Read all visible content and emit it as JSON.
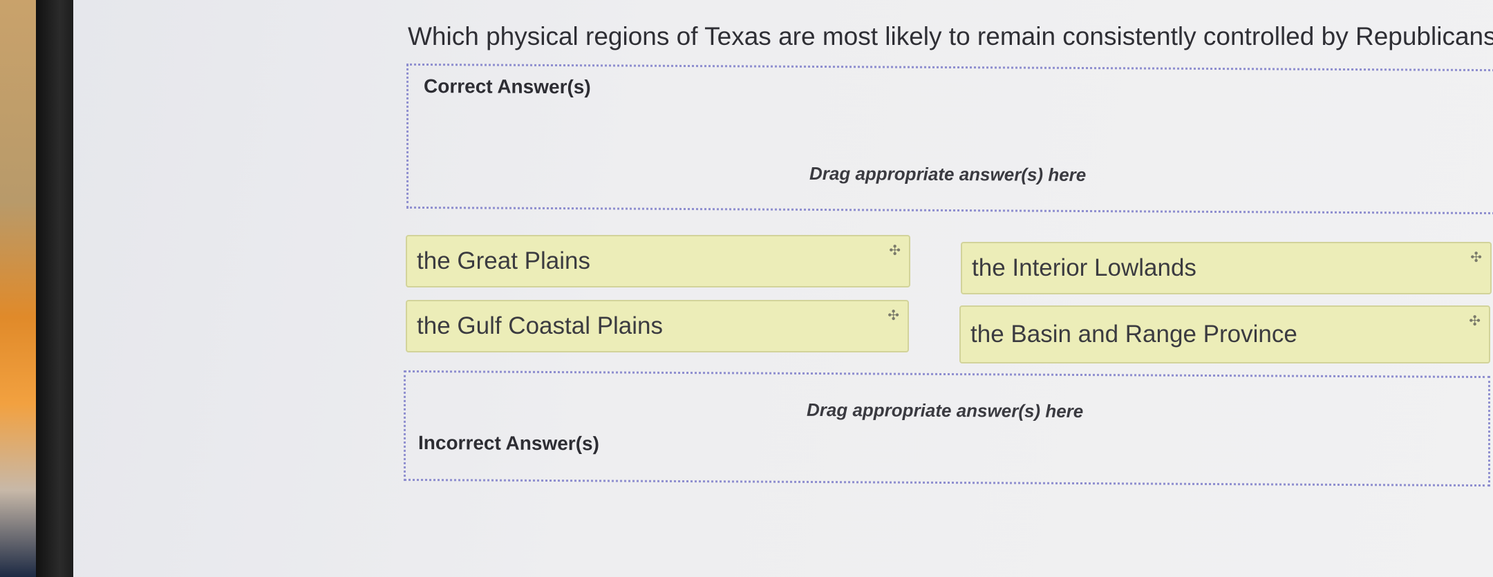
{
  "question": "Which physical regions of Texas are most likely to remain consistently controlled by Republicans?",
  "correct_zone": {
    "title": "Correct Answer(s)",
    "hint": "Drag appropriate answer(s) here"
  },
  "answers": [
    {
      "label": "the Great Plains",
      "icon": "move-icon"
    },
    {
      "label": "the Interior Lowlands",
      "icon": "move-icon"
    },
    {
      "label": "the Gulf Coastal Plains",
      "icon": "move-icon"
    },
    {
      "label": "the Basin and Range Province",
      "icon": "move-icon"
    }
  ],
  "incorrect_zone": {
    "title": "Incorrect Answer(s)",
    "hint": "Drag appropriate answer(s) here"
  },
  "colors": {
    "answer_bg": "#ecedb8",
    "dropzone_border": "#8e8ecf"
  }
}
